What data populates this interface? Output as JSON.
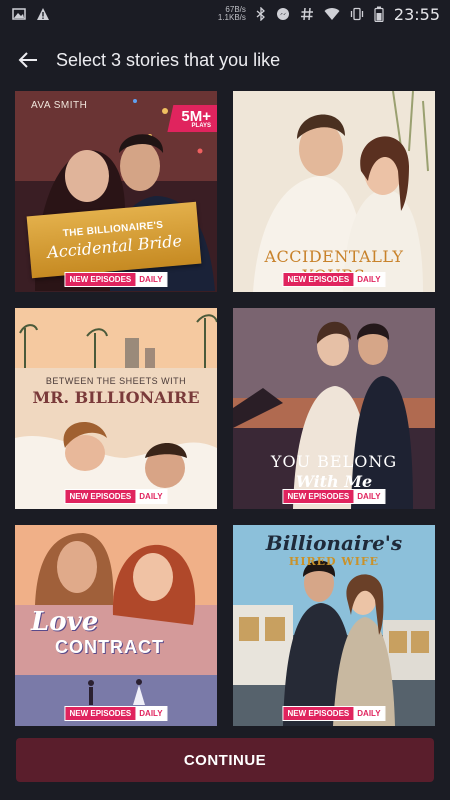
{
  "status_bar": {
    "net_speed_up": "67B/s",
    "net_speed_down": "1.1KB/s",
    "time": "23:55",
    "icons": [
      "image-icon",
      "warning-icon",
      "bluetooth-icon",
      "messenger-icon",
      "hashtag-icon",
      "wifi-icon",
      "vibrate-icon",
      "battery-icon"
    ]
  },
  "header": {
    "title": "Select 3 stories that you like",
    "back_icon": "arrow-left-icon"
  },
  "badge": {
    "part1": "NEW EPISODES",
    "part2": "DAILY"
  },
  "stories": [
    {
      "author": "AVA SMITH",
      "plays": "5M+",
      "plays_label": "PLAYS",
      "title_line1": "THE BILLIONAIRE'S",
      "title_line2": "Accidental Bride"
    },
    {
      "title_line1": "ACCIDENTALLY YOURS"
    },
    {
      "title_line1": "BETWEEN THE SHEETS WITH",
      "title_line2": "MR. BILLIONAIRE"
    },
    {
      "title_line1": "YOU BELONG",
      "title_line2": "With Me"
    },
    {
      "title_line1": "Love",
      "title_line2": "CONTRACT"
    },
    {
      "title_line1": "Billionaire's",
      "title_line2": "HIRED WIFE"
    }
  ],
  "continue_label": "CONTINUE",
  "colors": {
    "background": "#1b1c24",
    "continue_button": "#5a1e2c",
    "badge_accent": "#e0245e"
  }
}
